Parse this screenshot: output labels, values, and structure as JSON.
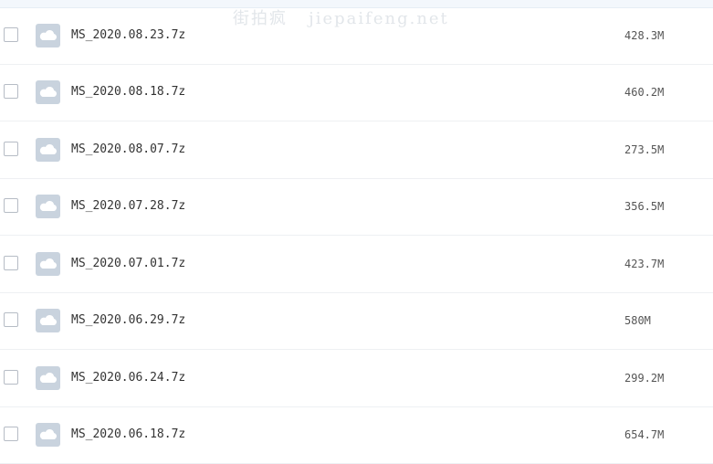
{
  "watermark": "街拍疯   jiepaifeng.net",
  "files": [
    {
      "name": "MS_2020.08.23.7z",
      "size": "428.3M",
      "icon": "archive-cloud-icon"
    },
    {
      "name": "MS_2020.08.18.7z",
      "size": "460.2M",
      "icon": "archive-cloud-icon"
    },
    {
      "name": "MS_2020.08.07.7z",
      "size": "273.5M",
      "icon": "archive-cloud-icon"
    },
    {
      "name": "MS_2020.07.28.7z",
      "size": "356.5M",
      "icon": "archive-cloud-icon"
    },
    {
      "name": "MS_2020.07.01.7z",
      "size": "423.7M",
      "icon": "archive-cloud-icon"
    },
    {
      "name": "MS_2020.06.29.7z",
      "size": "580M",
      "icon": "archive-cloud-icon"
    },
    {
      "name": "MS_2020.06.24.7z",
      "size": "299.2M",
      "icon": "archive-cloud-icon"
    },
    {
      "name": "MS_2020.06.18.7z",
      "size": "654.7M",
      "icon": "archive-cloud-icon"
    }
  ],
  "colors": {
    "icon_bg": "#c9d3de",
    "icon_fg": "#ffffff",
    "row_border": "#eef0f3",
    "checkbox_border": "#b6bcc5"
  }
}
